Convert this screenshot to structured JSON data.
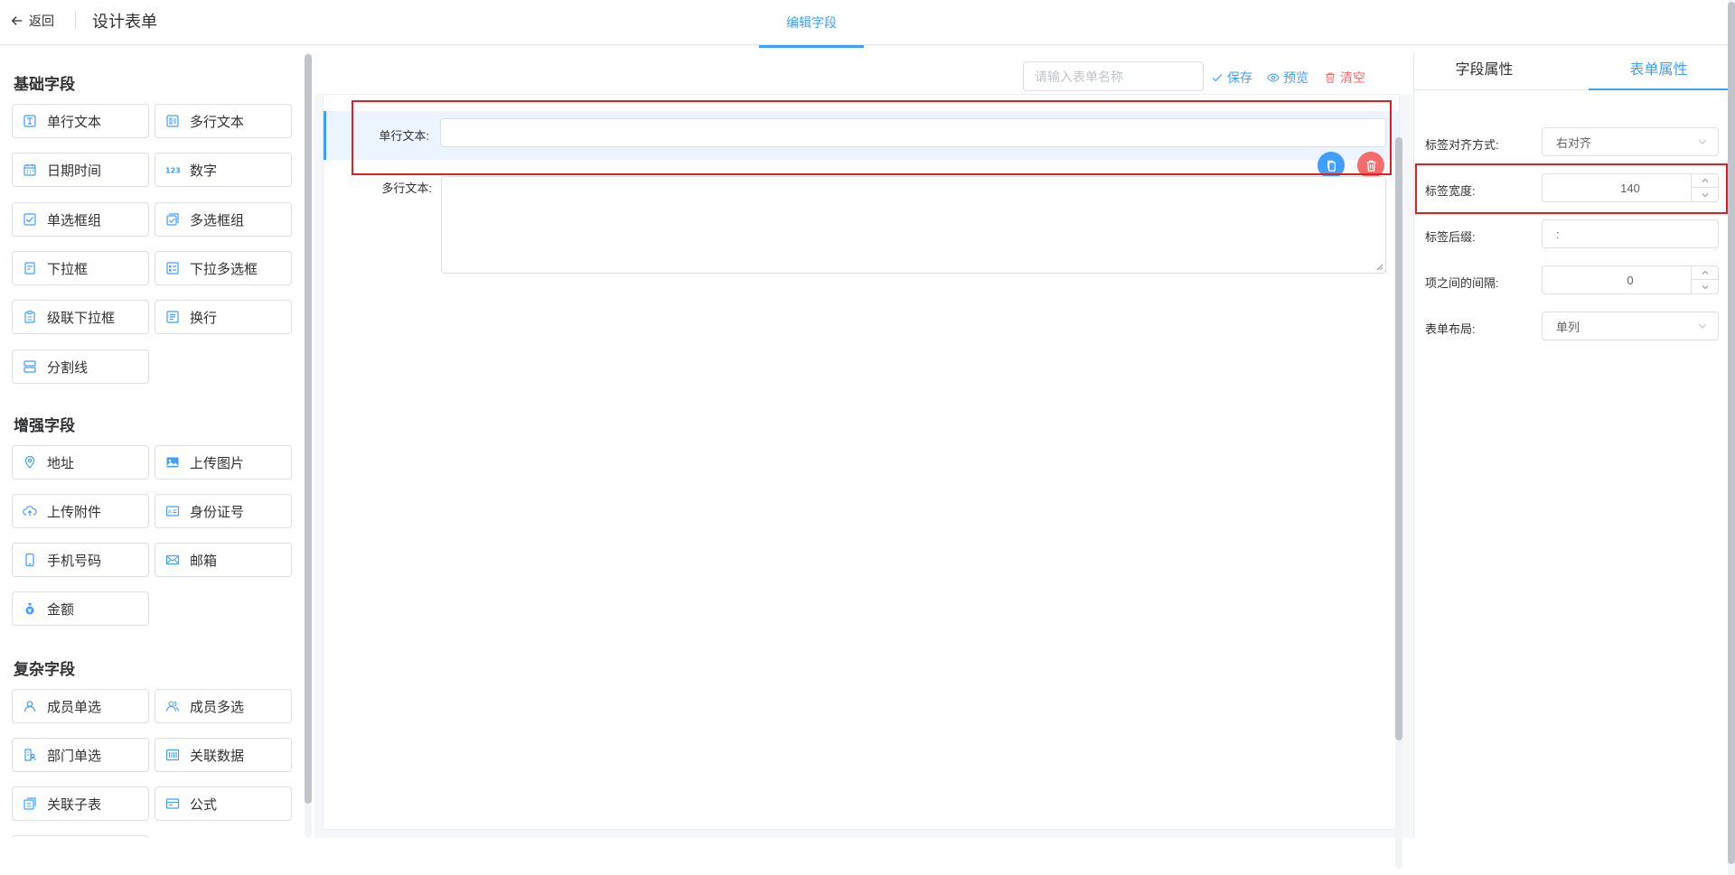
{
  "header": {
    "back_label": "返回",
    "title": "设计表单",
    "active_tab": "编辑字段"
  },
  "left": {
    "groups": [
      {
        "title": "基础字段",
        "items": [
          {
            "label": "单行文本",
            "icon": "text-icon"
          },
          {
            "label": "多行文本",
            "icon": "multiline-icon"
          },
          {
            "label": "日期时间",
            "icon": "calendar-icon"
          },
          {
            "label": "数字",
            "icon": "number-icon"
          },
          {
            "label": "单选框组",
            "icon": "radio-icon"
          },
          {
            "label": "多选框组",
            "icon": "checkbox-icon"
          },
          {
            "label": "下拉框",
            "icon": "select-icon"
          },
          {
            "label": "下拉多选框",
            "icon": "multi-select-icon"
          },
          {
            "label": "级联下拉框",
            "icon": "cascader-icon"
          },
          {
            "label": "换行",
            "icon": "newline-icon"
          },
          {
            "label": "分割线",
            "icon": "divider-icon"
          }
        ]
      },
      {
        "title": "增强字段",
        "items": [
          {
            "label": "地址",
            "icon": "location-icon"
          },
          {
            "label": "上传图片",
            "icon": "image-icon"
          },
          {
            "label": "上传附件",
            "icon": "upload-icon"
          },
          {
            "label": "身份证号",
            "icon": "id-card-icon"
          },
          {
            "label": "手机号码",
            "icon": "phone-icon"
          },
          {
            "label": "邮箱",
            "icon": "mail-icon"
          },
          {
            "label": "金额",
            "icon": "money-icon"
          }
        ]
      },
      {
        "title": "复杂字段",
        "items": [
          {
            "label": "成员单选",
            "icon": "user-icon"
          },
          {
            "label": "成员多选",
            "icon": "users-icon"
          },
          {
            "label": "部门单选",
            "icon": "department-icon"
          },
          {
            "label": "关联数据",
            "icon": "relation-icon"
          },
          {
            "label": "关联子表",
            "icon": "subtable-icon"
          },
          {
            "label": "公式",
            "icon": "formula-icon"
          }
        ]
      }
    ]
  },
  "toolbar": {
    "name_placeholder": "请输入表单名称",
    "save": "保存",
    "preview": "预览",
    "clear": "清空"
  },
  "canvas": {
    "field1_label": "单行文本:",
    "field2_label": "多行文本:"
  },
  "right": {
    "tab_field": "字段属性",
    "tab_form": "表单属性",
    "props": {
      "align_label": "标签对齐方式:",
      "align_value": "右对齐",
      "width_label": "标签宽度:",
      "width_value": "140",
      "suffix_label": "标签后缀:",
      "suffix_value": ":",
      "gap_label": "项之间的间隔:",
      "gap_value": "0",
      "layout_label": "表单布局:",
      "layout_value": "单列"
    }
  },
  "colors": {
    "primary": "#409eff",
    "danger": "#f56c6c",
    "highlight": "#e02020"
  }
}
